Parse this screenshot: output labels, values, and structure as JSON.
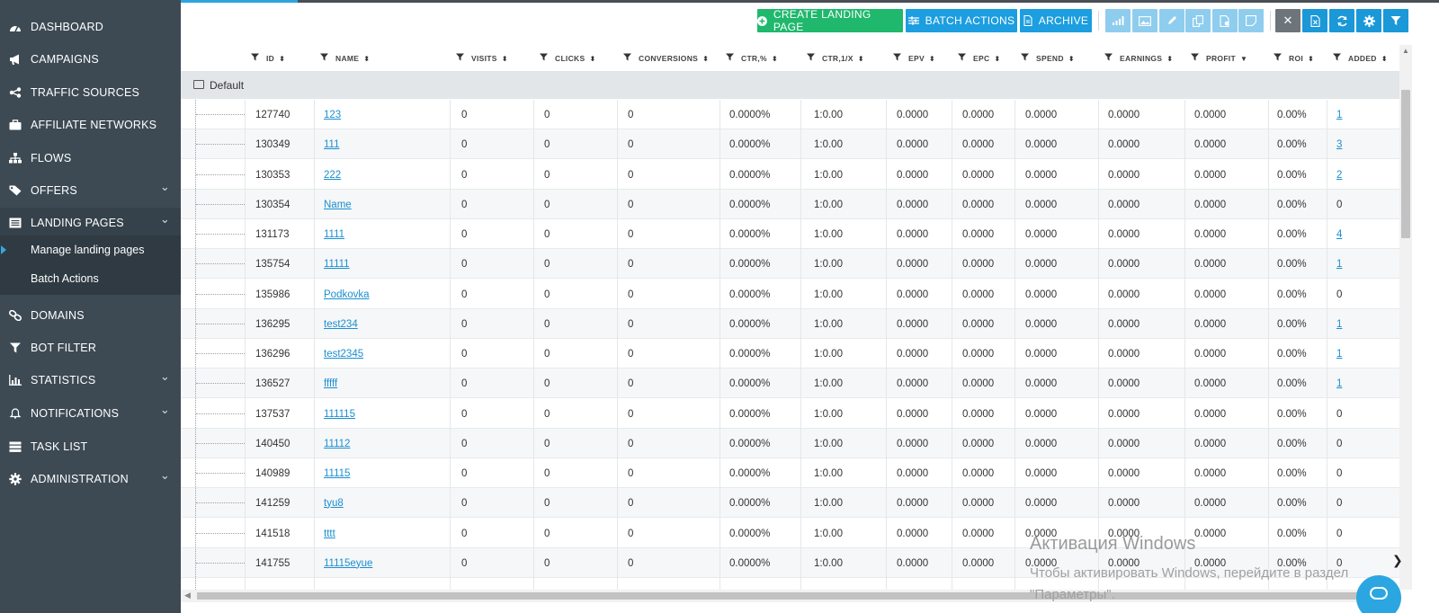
{
  "sidebar": {
    "items": [
      {
        "label": "DASHBOARD",
        "icon": "dashboard-icon",
        "chevron": false
      },
      {
        "label": "CAMPAIGNS",
        "icon": "megaphone-icon",
        "chevron": false
      },
      {
        "label": "TRAFFIC SOURCES",
        "icon": "share-icon",
        "chevron": false
      },
      {
        "label": "AFFILIATE NETWORKS",
        "icon": "briefcase-icon",
        "chevron": false
      },
      {
        "label": "FLOWS",
        "icon": "sitemap-icon",
        "chevron": false
      },
      {
        "label": "OFFERS",
        "icon": "tag-icon",
        "chevron": true
      },
      {
        "label": "LANDING PAGES",
        "icon": "list-icon",
        "chevron": true
      },
      {
        "label": "DOMAINS",
        "icon": "link-icon",
        "chevron": false
      },
      {
        "label": "BOT FILTER",
        "icon": "filter-icon",
        "chevron": false
      },
      {
        "label": "STATISTICS",
        "icon": "bar-chart-icon",
        "chevron": true
      },
      {
        "label": "NOTIFICATIONS",
        "icon": "bell-icon",
        "chevron": true
      },
      {
        "label": "TASK LIST",
        "icon": "task-list-icon",
        "chevron": false
      },
      {
        "label": "ADMINISTRATION",
        "icon": "gear-icon",
        "chevron": true
      }
    ],
    "submenu": [
      {
        "label": "Manage landing pages",
        "active": true
      },
      {
        "label": "Batch Actions",
        "active": false
      }
    ]
  },
  "toolbar": {
    "create_label": "CREATE LANDING PAGE",
    "batch_label": "BATCH ACTIONS",
    "archive_label": "ARCHIVE"
  },
  "table": {
    "columns": [
      "ID",
      "NAME",
      "VISITS",
      "CLICKS",
      "CONVERSIONS",
      "CTR,%",
      "CTR,1/X",
      "EPV",
      "EPC",
      "SPEND",
      "EARNINGS",
      "PROFIT",
      "ROI",
      "ADDED"
    ],
    "folder": "Default",
    "rows": [
      [
        "127740",
        "123",
        "0",
        "0",
        "0",
        "0.0000%",
        "1:0.00",
        "0.0000",
        "0.0000",
        "0.0000",
        "0.0000",
        "0.0000",
        "0.00%",
        "1"
      ],
      [
        "130349",
        "111",
        "0",
        "0",
        "0",
        "0.0000%",
        "1:0.00",
        "0.0000",
        "0.0000",
        "0.0000",
        "0.0000",
        "0.0000",
        "0.00%",
        "3"
      ],
      [
        "130353",
        "222",
        "0",
        "0",
        "0",
        "0.0000%",
        "1:0.00",
        "0.0000",
        "0.0000",
        "0.0000",
        "0.0000",
        "0.0000",
        "0.00%",
        "2"
      ],
      [
        "130354",
        "Name",
        "0",
        "0",
        "0",
        "0.0000%",
        "1:0.00",
        "0.0000",
        "0.0000",
        "0.0000",
        "0.0000",
        "0.0000",
        "0.00%",
        "0"
      ],
      [
        "131173",
        "1111",
        "0",
        "0",
        "0",
        "0.0000%",
        "1:0.00",
        "0.0000",
        "0.0000",
        "0.0000",
        "0.0000",
        "0.0000",
        "0.00%",
        "4"
      ],
      [
        "135754",
        "11111",
        "0",
        "0",
        "0",
        "0.0000%",
        "1:0.00",
        "0.0000",
        "0.0000",
        "0.0000",
        "0.0000",
        "0.0000",
        "0.00%",
        "1"
      ],
      [
        "135986",
        "Podkovka",
        "0",
        "0",
        "0",
        "0.0000%",
        "1:0.00",
        "0.0000",
        "0.0000",
        "0.0000",
        "0.0000",
        "0.0000",
        "0.00%",
        "0"
      ],
      [
        "136295",
        "test234",
        "0",
        "0",
        "0",
        "0.0000%",
        "1:0.00",
        "0.0000",
        "0.0000",
        "0.0000",
        "0.0000",
        "0.0000",
        "0.00%",
        "1"
      ],
      [
        "136296",
        "test2345",
        "0",
        "0",
        "0",
        "0.0000%",
        "1:0.00",
        "0.0000",
        "0.0000",
        "0.0000",
        "0.0000",
        "0.0000",
        "0.00%",
        "1"
      ],
      [
        "136527",
        "fffff",
        "0",
        "0",
        "0",
        "0.0000%",
        "1:0.00",
        "0.0000",
        "0.0000",
        "0.0000",
        "0.0000",
        "0.0000",
        "0.00%",
        "1"
      ],
      [
        "137537",
        "111115",
        "0",
        "0",
        "0",
        "0.0000%",
        "1:0.00",
        "0.0000",
        "0.0000",
        "0.0000",
        "0.0000",
        "0.0000",
        "0.00%",
        "0"
      ],
      [
        "140450",
        "11112",
        "0",
        "0",
        "0",
        "0.0000%",
        "1:0.00",
        "0.0000",
        "0.0000",
        "0.0000",
        "0.0000",
        "0.0000",
        "0.00%",
        "0"
      ],
      [
        "140989",
        "11115",
        "0",
        "0",
        "0",
        "0.0000%",
        "1:0.00",
        "0.0000",
        "0.0000",
        "0.0000",
        "0.0000",
        "0.0000",
        "0.00%",
        "0"
      ],
      [
        "141259",
        "tyu8",
        "0",
        "0",
        "0",
        "0.0000%",
        "1:0.00",
        "0.0000",
        "0.0000",
        "0.0000",
        "0.0000",
        "0.0000",
        "0.00%",
        "0"
      ],
      [
        "141518",
        "tttt",
        "0",
        "0",
        "0",
        "0.0000%",
        "1:0.00",
        "0.0000",
        "0.0000",
        "0.0000",
        "0.0000",
        "0.0000",
        "0.00%",
        "0"
      ],
      [
        "141755",
        "11115eyue",
        "0",
        "0",
        "0",
        "0.0000%",
        "1:0.00",
        "0.0000",
        "0.0000",
        "0.0000",
        "0.0000",
        "0.0000",
        "0.00%",
        "0"
      ]
    ]
  },
  "watermark": {
    "title": "Активация Windows",
    "text": "Чтобы активировать Windows, перейдите в раздел \"Параметры\"."
  },
  "colors": {
    "sidebar": "#3d4a54",
    "accent": "#1c9ee0",
    "create_button": "#1fb86c",
    "link": "#1a8fd0"
  }
}
